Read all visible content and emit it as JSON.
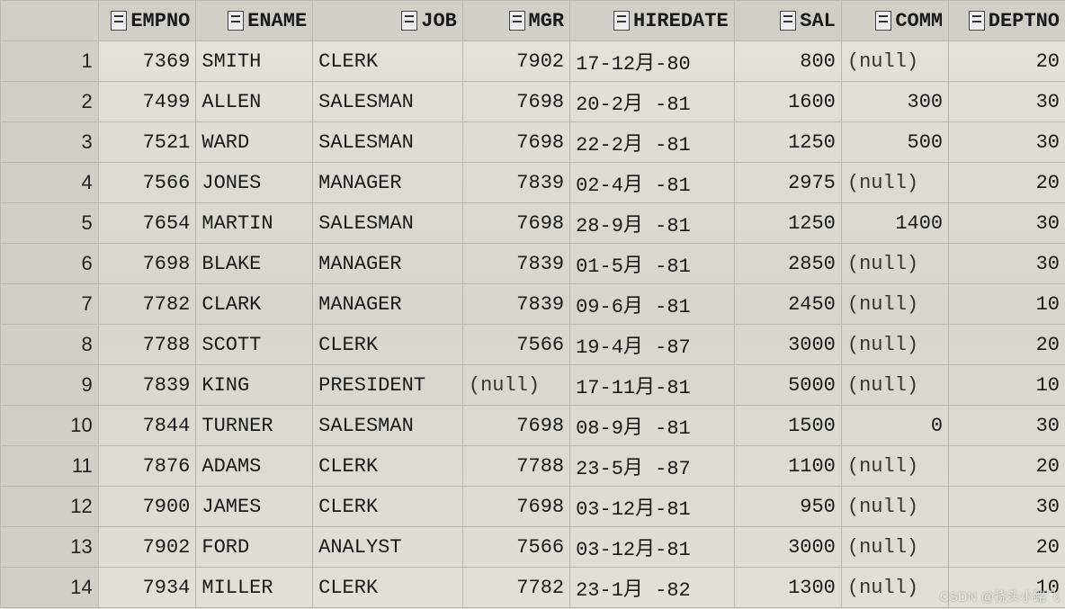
{
  "null_text": "(null)",
  "columns": [
    {
      "key": "EMPNO",
      "label": "EMPNO",
      "align": "num",
      "cls": "col-empno"
    },
    {
      "key": "ENAME",
      "label": "ENAME",
      "align": "txt",
      "cls": "col-ename"
    },
    {
      "key": "JOB",
      "label": "JOB",
      "align": "txt",
      "cls": "col-job"
    },
    {
      "key": "MGR",
      "label": "MGR",
      "align": "num",
      "cls": "col-mgr"
    },
    {
      "key": "HIREDATE",
      "label": "HIREDATE",
      "align": "txt",
      "cls": "col-hiredate"
    },
    {
      "key": "SAL",
      "label": "SAL",
      "align": "num",
      "cls": "col-sal"
    },
    {
      "key": "COMM",
      "label": "COMM",
      "align": "num",
      "cls": "col-comm"
    },
    {
      "key": "DEPTNO",
      "label": "DEPTNO",
      "align": "num",
      "cls": "col-deptno"
    }
  ],
  "rows": [
    {
      "n": 1,
      "EMPNO": "7369",
      "ENAME": "SMITH",
      "JOB": "CLERK",
      "MGR": "7902",
      "HIREDATE": "17-12月-80",
      "SAL": "800",
      "COMM": null,
      "DEPTNO": "20"
    },
    {
      "n": 2,
      "EMPNO": "7499",
      "ENAME": "ALLEN",
      "JOB": "SALESMAN",
      "MGR": "7698",
      "HIREDATE": "20-2月 -81",
      "SAL": "1600",
      "COMM": "300",
      "DEPTNO": "30"
    },
    {
      "n": 3,
      "EMPNO": "7521",
      "ENAME": "WARD",
      "JOB": "SALESMAN",
      "MGR": "7698",
      "HIREDATE": "22-2月 -81",
      "SAL": "1250",
      "COMM": "500",
      "DEPTNO": "30"
    },
    {
      "n": 4,
      "EMPNO": "7566",
      "ENAME": "JONES",
      "JOB": "MANAGER",
      "MGR": "7839",
      "HIREDATE": "02-4月 -81",
      "SAL": "2975",
      "COMM": null,
      "DEPTNO": "20"
    },
    {
      "n": 5,
      "EMPNO": "7654",
      "ENAME": "MARTIN",
      "JOB": "SALESMAN",
      "MGR": "7698",
      "HIREDATE": "28-9月 -81",
      "SAL": "1250",
      "COMM": "1400",
      "DEPTNO": "30"
    },
    {
      "n": 6,
      "EMPNO": "7698",
      "ENAME": "BLAKE",
      "JOB": "MANAGER",
      "MGR": "7839",
      "HIREDATE": "01-5月 -81",
      "SAL": "2850",
      "COMM": null,
      "DEPTNO": "30"
    },
    {
      "n": 7,
      "EMPNO": "7782",
      "ENAME": "CLARK",
      "JOB": "MANAGER",
      "MGR": "7839",
      "HIREDATE": "09-6月 -81",
      "SAL": "2450",
      "COMM": null,
      "DEPTNO": "10"
    },
    {
      "n": 8,
      "EMPNO": "7788",
      "ENAME": "SCOTT",
      "JOB": "CLERK",
      "MGR": "7566",
      "HIREDATE": "19-4月 -87",
      "SAL": "3000",
      "COMM": null,
      "DEPTNO": "20"
    },
    {
      "n": 9,
      "EMPNO": "7839",
      "ENAME": "KING",
      "JOB": "PRESIDENT",
      "MGR": null,
      "HIREDATE": "17-11月-81",
      "SAL": "5000",
      "COMM": null,
      "DEPTNO": "10"
    },
    {
      "n": 10,
      "EMPNO": "7844",
      "ENAME": "TURNER",
      "JOB": "SALESMAN",
      "MGR": "7698",
      "HIREDATE": "08-9月 -81",
      "SAL": "1500",
      "COMM": "0",
      "DEPTNO": "30"
    },
    {
      "n": 11,
      "EMPNO": "7876",
      "ENAME": "ADAMS",
      "JOB": "CLERK",
      "MGR": "7788",
      "HIREDATE": "23-5月 -87",
      "SAL": "1100",
      "COMM": null,
      "DEPTNO": "20"
    },
    {
      "n": 12,
      "EMPNO": "7900",
      "ENAME": "JAMES",
      "JOB": "CLERK",
      "MGR": "7698",
      "HIREDATE": "03-12月-81",
      "SAL": "950",
      "COMM": null,
      "DEPTNO": "30"
    },
    {
      "n": 13,
      "EMPNO": "7902",
      "ENAME": "FORD",
      "JOB": "ANALYST",
      "MGR": "7566",
      "HIREDATE": "03-12月-81",
      "SAL": "3000",
      "COMM": null,
      "DEPTNO": "20"
    },
    {
      "n": 14,
      "EMPNO": "7934",
      "ENAME": "MILLER",
      "JOB": "CLERK",
      "MGR": "7782",
      "HIREDATE": "23-1月 -82",
      "SAL": "1300",
      "COMM": null,
      "DEPTNO": "10"
    }
  ],
  "watermark": "CSDN @挠头小路飞"
}
